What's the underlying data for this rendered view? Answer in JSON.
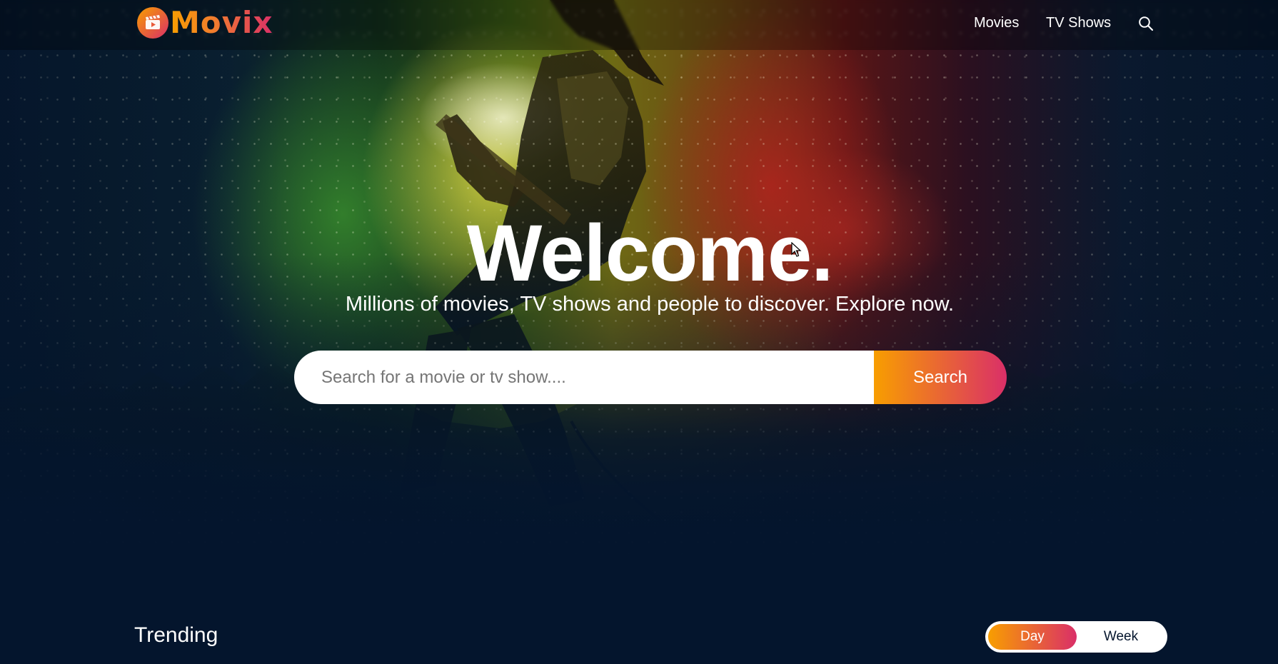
{
  "brand": {
    "name": "Movix",
    "icon": "film-clapper-icon",
    "gradient_start": "#f89e00",
    "gradient_end": "#da2f68"
  },
  "nav": {
    "items": [
      {
        "label": "Movies"
      },
      {
        "label": "TV Shows"
      }
    ],
    "search_icon": "search-icon"
  },
  "hero": {
    "title": "Welcome.",
    "subtitle": "Millions of movies, TV shows and people to discover. Explore now.",
    "search": {
      "placeholder": "Search for a movie or tv show....",
      "value": "",
      "button_label": "Search"
    }
  },
  "trending": {
    "title": "Trending",
    "tabs": [
      {
        "label": "Day",
        "active": true
      },
      {
        "label": "Week",
        "active": false
      }
    ]
  },
  "colors": {
    "background": "#04152d",
    "text": "#ffffff"
  }
}
